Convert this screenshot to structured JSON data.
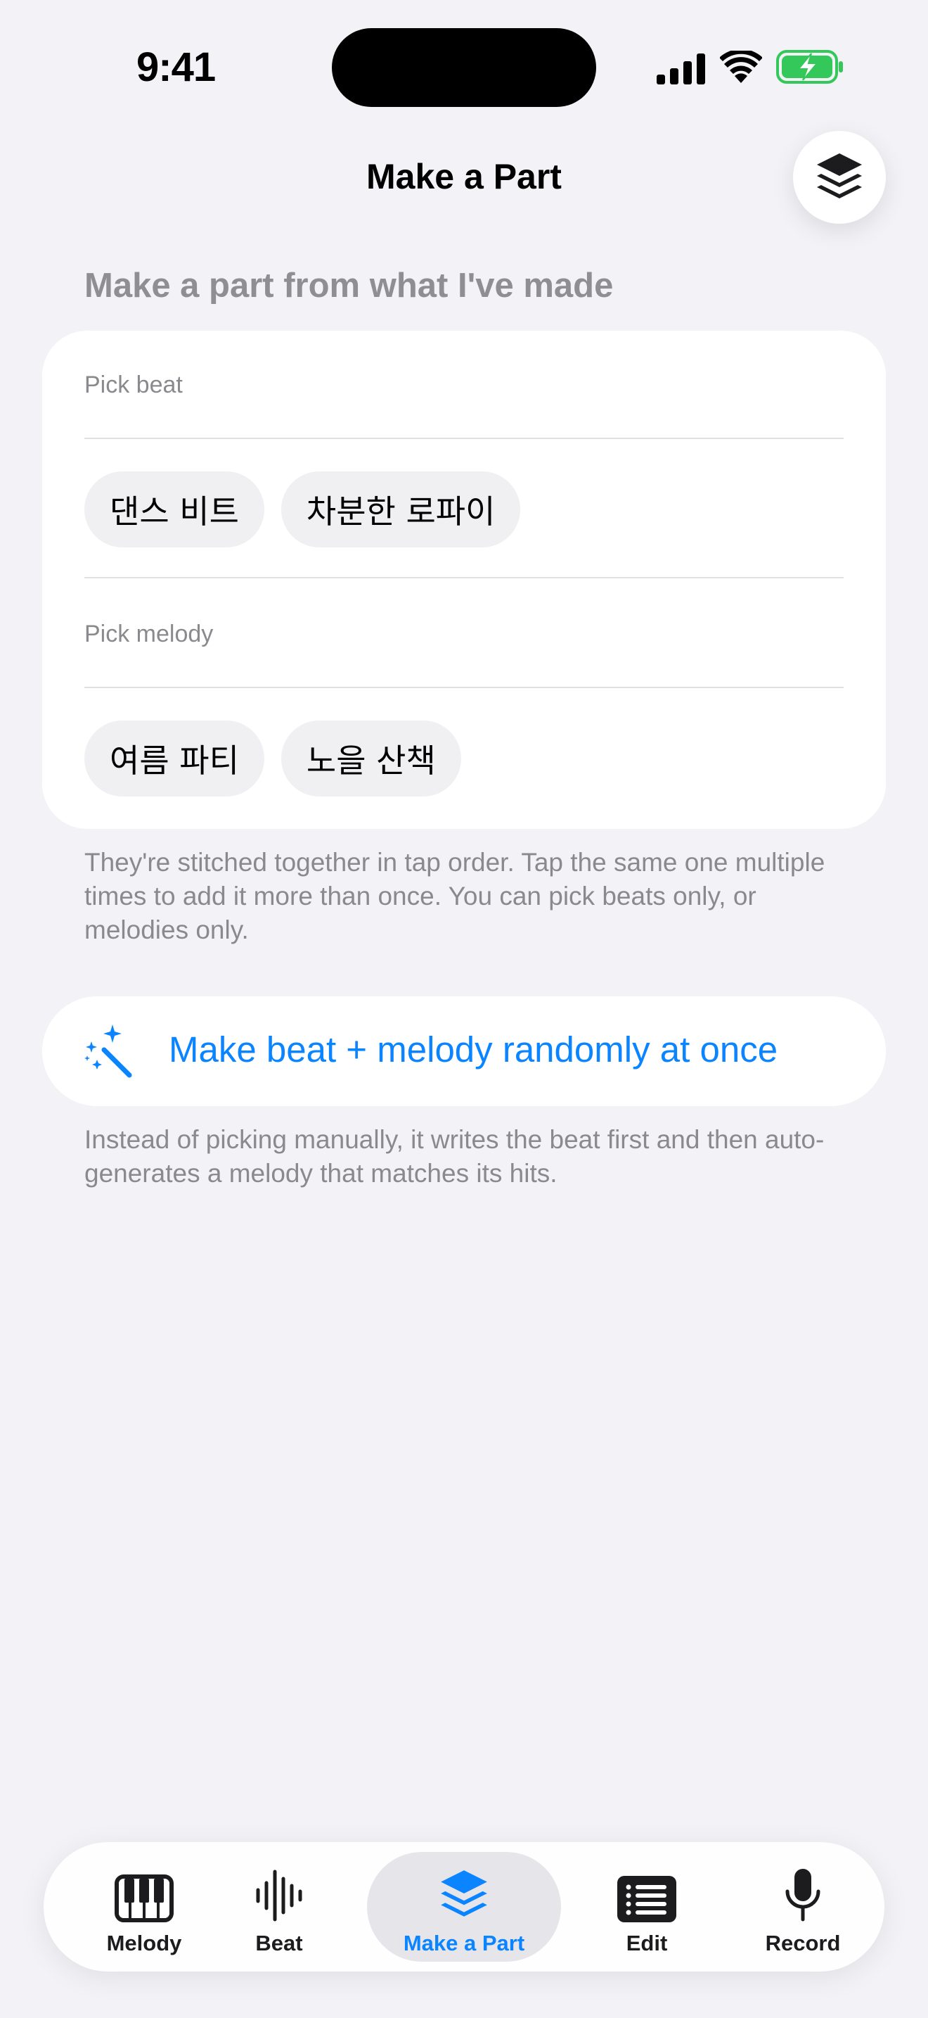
{
  "status_bar": {
    "time": "9:41"
  },
  "nav": {
    "title": "Make a Part",
    "layers_button_icon": "layers-icon"
  },
  "section": {
    "header": "Make a part from what I've made"
  },
  "beat_picker": {
    "label": "Pick beat",
    "chips": [
      "댄스 비트",
      "차분한 로파이"
    ]
  },
  "melody_picker": {
    "label": "Pick melody",
    "chips": [
      "여름 파티",
      "노을 산책"
    ]
  },
  "picker_footnote": "They're stitched together in tap order. Tap the same one multiple times to add it more than once. You can pick beats only, or melodies only.",
  "random_button": {
    "label": "Make beat + melody randomly at once",
    "icon": "magic-wand-icon"
  },
  "random_footnote": "Instead of picking manually, it writes the beat first and then auto-generates a melody that matches its hits.",
  "tab_bar": {
    "tabs": [
      {
        "label": "Melody",
        "icon": "piano-keys-icon",
        "active": false
      },
      {
        "label": "Beat",
        "icon": "waveform-icon",
        "active": false
      },
      {
        "label": "Make a Part",
        "icon": "layers-icon",
        "active": true
      },
      {
        "label": "Edit",
        "icon": "list-icon",
        "active": false
      },
      {
        "label": "Record",
        "icon": "microphone-icon",
        "active": false
      }
    ]
  },
  "colors": {
    "accent": "#0A84FF",
    "background": "#F2F2F7",
    "secondary_text": "#8A8A8E",
    "battery_green": "#34C759"
  }
}
